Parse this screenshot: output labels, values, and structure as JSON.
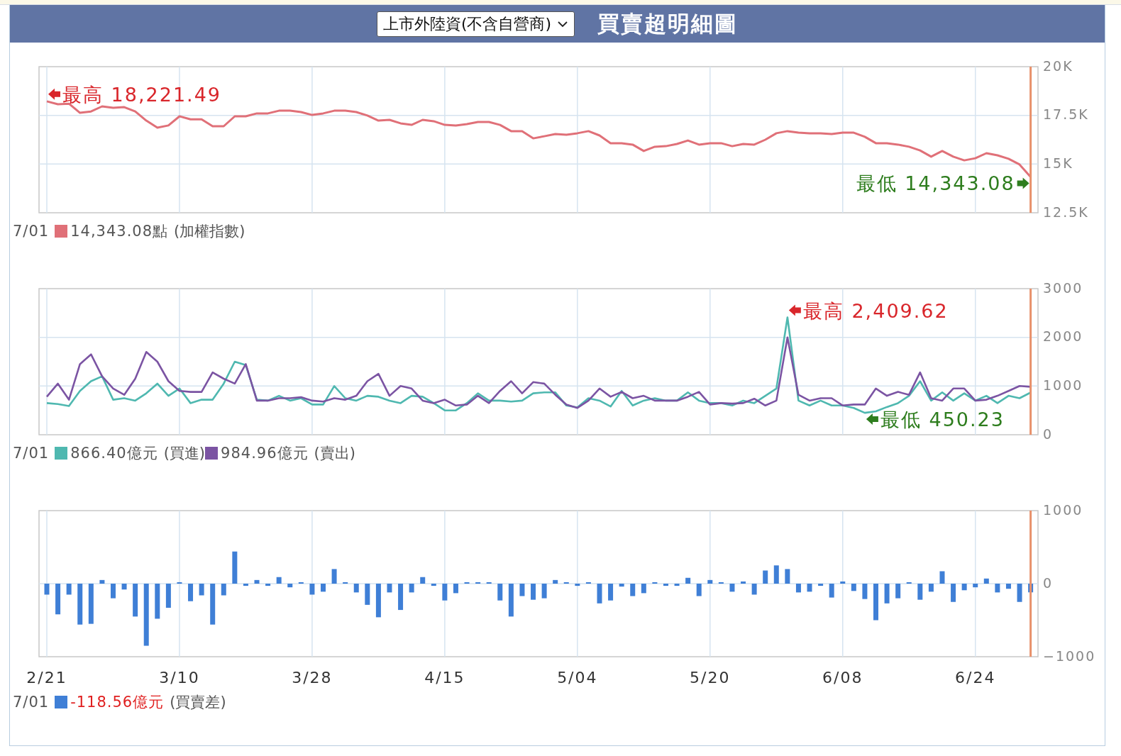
{
  "header": {
    "select": {
      "value": "上市外陸資(不含自營商)"
    },
    "title": "買賣超明細圖"
  },
  "charts": [
    {
      "chart_data": {
        "type": "line",
        "ylim": [
          12500,
          20000
        ],
        "yticks": [
          {
            "value": 12500,
            "label": "12.5K"
          },
          {
            "value": 15000,
            "label": "15K"
          },
          {
            "value": 17500,
            "label": "17.5K"
          },
          {
            "value": 20000,
            "label": "20K"
          }
        ],
        "grid": true,
        "series": [
          {
            "name": "(加權指數)",
            "color": "#e07078",
            "values": [
              18221,
              18070,
              18100,
              17630,
              17700,
              17960,
              17890,
              17920,
              17700,
              17230,
              16870,
              16980,
              17450,
              17300,
              17300,
              16940,
              16940,
              17450,
              17450,
              17600,
              17600,
              17740,
              17740,
              17670,
              17520,
              17600,
              17740,
              17740,
              17670,
              17490,
              17230,
              17270,
              17090,
              17010,
              17270,
              17200,
              17010,
              16980,
              17050,
              17160,
              17160,
              17010,
              16690,
              16690,
              16320,
              16430,
              16540,
              16500,
              16580,
              16690,
              16470,
              16070,
              16070,
              16000,
              15670,
              15890,
              15920,
              16030,
              16210,
              16000,
              16070,
              16070,
              15920,
              16030,
              16000,
              16250,
              16580,
              16690,
              16610,
              16580,
              16580,
              16540,
              16610,
              16610,
              16400,
              16070,
              16070,
              16000,
              15890,
              15700,
              15380,
              15670,
              15380,
              15190,
              15300,
              15560,
              15450,
              15270,
              14980,
              14343
            ]
          }
        ],
        "annotations": [
          "最高 18,221.49",
          "最低 14,343.08"
        ]
      },
      "legend": {
        "date": "7/01",
        "items": [
          {
            "value": "14,343.08點",
            "value_highlight": false
          }
        ]
      }
    },
    {
      "chart_data": {
        "type": "line",
        "ylim": [
          0,
          3000
        ],
        "yticks": [
          0,
          1000,
          2000,
          3000
        ],
        "grid": true,
        "series": [
          {
            "name": "(買進)",
            "color": "#4fb8b0",
            "values": [
              650,
              630,
              590,
              900,
              1100,
              1200,
              720,
              750,
              700,
              850,
              1050,
              800,
              950,
              650,
              720,
              720,
              1050,
              1500,
              1430,
              720,
              700,
              800,
              700,
              750,
              620,
              620,
              1000,
              750,
              700,
              800,
              780,
              700,
              650,
              800,
              780,
              650,
              500,
              500,
              650,
              850,
              700,
              700,
              680,
              700,
              850,
              870,
              870,
              600,
              560,
              750,
              700,
              580,
              900,
              600,
              700,
              750,
              700,
              700,
              870,
              700,
              650,
              650,
              600,
              700,
              650,
              800,
              950,
              2410,
              700,
              600,
              700,
              600,
              600,
              550,
              450,
              480,
              570,
              650,
              800,
              1100,
              700,
              870,
              700,
              850,
              700,
              800,
              650,
              800,
              750,
              866
            ]
          },
          {
            "name": "(賣出)",
            "color": "#7b54a3",
            "values": [
              780,
              1050,
              720,
              1450,
              1650,
              1200,
              950,
              820,
              1150,
              1700,
              1500,
              1100,
              900,
              880,
              880,
              1280,
              1150,
              1050,
              1450,
              700,
              700,
              750,
              750,
              770,
              700,
              680,
              750,
              720,
              800,
              1100,
              1250,
              800,
              1000,
              950,
              700,
              650,
              720,
              600,
              620,
              800,
              650,
              900,
              1100,
              850,
              1080,
              1050,
              820,
              620,
              550,
              700,
              950,
              780,
              880,
              750,
              800,
              700,
              700,
              700,
              780,
              880,
              620,
              650,
              640,
              650,
              740,
              600,
              700,
              2000,
              820,
              700,
              750,
              750,
              600,
              620,
              620,
              950,
              800,
              880,
              820,
              1280,
              750,
              700,
              950,
              950,
              700,
              720,
              800,
              900,
              1000,
              985
            ]
          }
        ],
        "annotations": [
          "最高 2,409.62",
          "最低 450.23"
        ]
      },
      "legend": {
        "date": "7/01",
        "items": [
          {
            "value": "866.40億元",
            "value_highlight": false
          },
          {
            "value": "984.96億元",
            "value_highlight": false
          }
        ]
      }
    },
    {
      "chart_data": {
        "type": "bar",
        "ylim": [
          -1000,
          1000
        ],
        "yticks": [
          {
            "value": -1000,
            "label": "−1000"
          },
          0,
          1000
        ],
        "grid": true,
        "series": [
          {
            "name": "(買賣差)",
            "color": "#3f7fd6",
            "values": [
              -150,
              -420,
              -150,
              -560,
              -550,
              50,
              -200,
              -80,
              -450,
              -850,
              -480,
              -330,
              20,
              -240,
              -160,
              -560,
              -160,
              440,
              -30,
              50,
              -30,
              90,
              -50,
              20,
              -150,
              -110,
              200,
              20,
              -120,
              -290,
              -460,
              -120,
              -360,
              -120,
              90,
              -30,
              -230,
              -130,
              20,
              20,
              20,
              -230,
              -450,
              -170,
              -220,
              -200,
              50,
              20,
              -30,
              20,
              -270,
              -230,
              -40,
              -170,
              -130,
              20,
              -30,
              -30,
              80,
              -170,
              50,
              20,
              -110,
              30,
              -150,
              180,
              250,
              200,
              -120,
              -110,
              -30,
              -190,
              30,
              -100,
              -210,
              -500,
              -270,
              -200,
              20,
              -220,
              -110,
              170,
              -250,
              -90,
              -50,
              70,
              -120,
              -70,
              -250,
              -119
            ]
          }
        ]
      },
      "axis_labels": [
        "2/21",
        "3/10",
        "3/28",
        "4/15",
        "5/04",
        "5/20",
        "6/08",
        "6/24"
      ],
      "legend": {
        "date": "7/01",
        "items": [
          {
            "value": "-118.56億元",
            "value_highlight": true
          }
        ]
      }
    }
  ]
}
